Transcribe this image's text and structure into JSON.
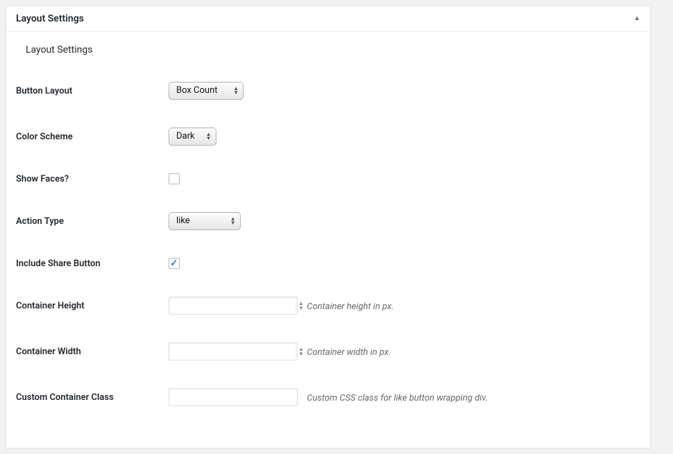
{
  "panel": {
    "title": "Layout Settings",
    "subheading": "Layout Settings"
  },
  "fields": {
    "button_layout": {
      "label": "Button Layout",
      "value": "Box Count"
    },
    "color_scheme": {
      "label": "Color Scheme",
      "value": "Dark"
    },
    "show_faces": {
      "label": "Show Faces?",
      "checked": false
    },
    "action_type": {
      "label": "Action Type",
      "value": "like"
    },
    "include_share": {
      "label": "Include Share Button",
      "checked": true
    },
    "container_height": {
      "label": "Container Height",
      "value": "",
      "hint": "Container height in px."
    },
    "container_width": {
      "label": "Container Width",
      "value": "",
      "hint": "Container width in px."
    },
    "custom_class": {
      "label": "Custom Container Class",
      "value": "",
      "hint": "Custom CSS class for like button wrapping div."
    }
  }
}
